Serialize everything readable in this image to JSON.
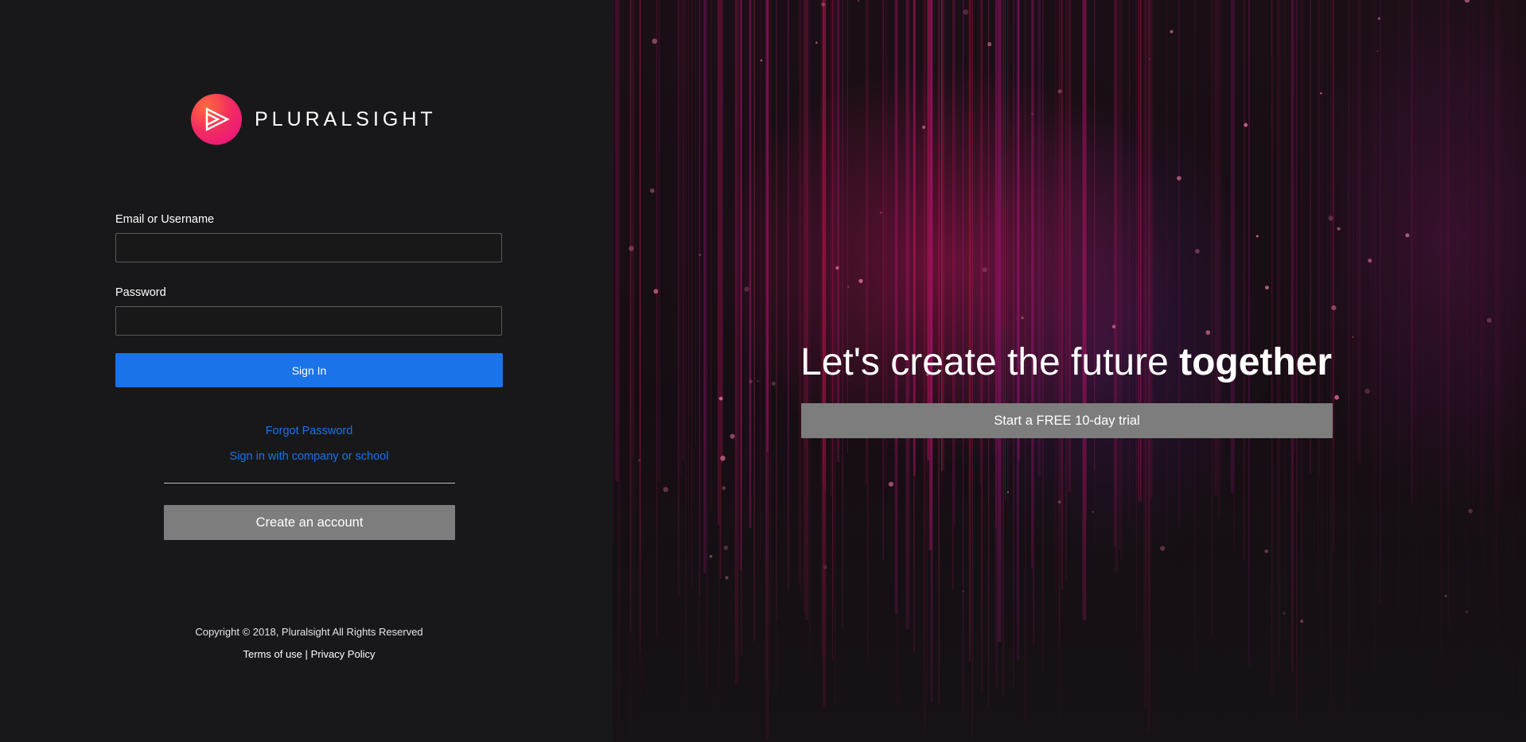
{
  "brand": {
    "name": "PLURALSIGHT",
    "colors": {
      "logo_gradient_start": "#ff6a3d",
      "logo_gradient_end": "#e80a89",
      "primary_blue": "#1a73e8",
      "button_gray": "#7d7d7d",
      "background": "#181818"
    }
  },
  "login_form": {
    "email_label": "Email or Username",
    "email_value": "",
    "email_placeholder": "",
    "password_label": "Password",
    "password_value": "",
    "password_placeholder": "",
    "signin_label": "Sign In"
  },
  "links": {
    "forgot_password": "Forgot Password",
    "company_signin": "Sign in with company or school"
  },
  "create_account_label": "Create an account",
  "footer": {
    "copyright": "Copyright © 2018, Pluralsight All Rights Reserved",
    "terms": "Terms of use",
    "separator": "|",
    "privacy": "Privacy Policy"
  },
  "hero": {
    "title_regular": "Let's create the future ",
    "title_bold": "together",
    "trial_label": "Start a FREE 10-day trial"
  },
  "icons": {
    "logo": "play-triangle-icon"
  }
}
